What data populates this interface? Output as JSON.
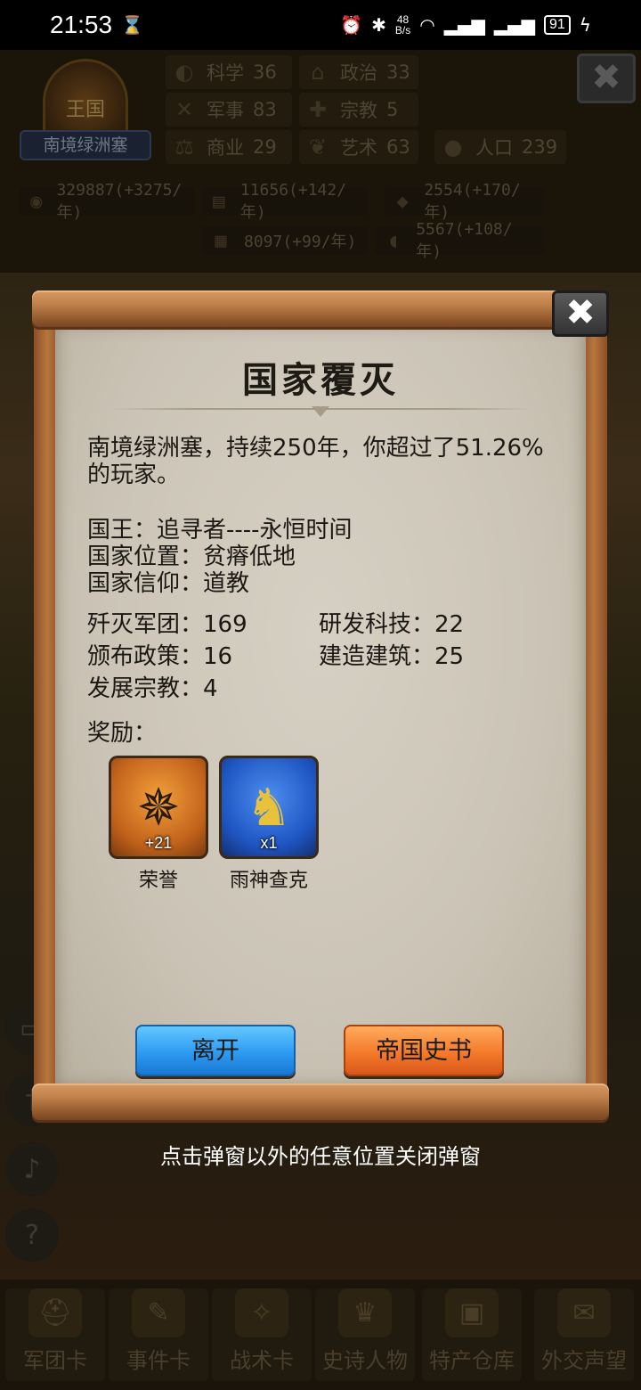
{
  "status_bar": {
    "time": "21:53",
    "hourglass_icon": "⌛",
    "net_speed_top": "48",
    "net_speed_bottom": "B/s",
    "battery": "91"
  },
  "background": {
    "kingdom_badge": "王国",
    "kingdom_name": "南境绿洲塞",
    "stats": [
      {
        "label": "科学",
        "value": "36"
      },
      {
        "label": "政治",
        "value": "33"
      },
      {
        "label": "军事",
        "value": "83"
      },
      {
        "label": "宗教",
        "value": "5"
      },
      {
        "label": "商业",
        "value": "29"
      },
      {
        "label": "艺术",
        "value": "63"
      },
      {
        "label": "人口",
        "value": "239"
      }
    ],
    "resources": [
      "329887(+3275/年)",
      "11656(+142/年)",
      "2554(+170/年)",
      "8097(+99/年)",
      "5567(+108/年)"
    ],
    "tabs": [
      "军团卡",
      "事件卡",
      "战术卡",
      "史诗人物",
      "特产仓库",
      "外交声望"
    ]
  },
  "modal": {
    "title": "国家覆灭",
    "summary": "南境绿洲塞，持续250年，你超过了51.26%的玩家。",
    "king": "国王：追寻者----永恒时间",
    "location": "国家位置：贫瘠低地",
    "faith": "国家信仰：道教",
    "destroyed_legions": "歼灭军团：169",
    "researched_tech": "研发科技：22",
    "issued_policies": "颁布政策：16",
    "built_buildings": "建造建筑：25",
    "developed_religions": "发展宗教：4",
    "rewards_label": "奖励：",
    "rewards": [
      {
        "name": "荣誉",
        "count": "+21",
        "icon": "honor-medal-icon"
      },
      {
        "name": "雨神查克",
        "count": "x1",
        "icon": "hero-portrait-icon"
      }
    ],
    "leave_button": "离开",
    "history_button": "帝国史书",
    "close_icon": "✖"
  },
  "hint": "点击弹窗以外的任意位置关闭弹窗"
}
